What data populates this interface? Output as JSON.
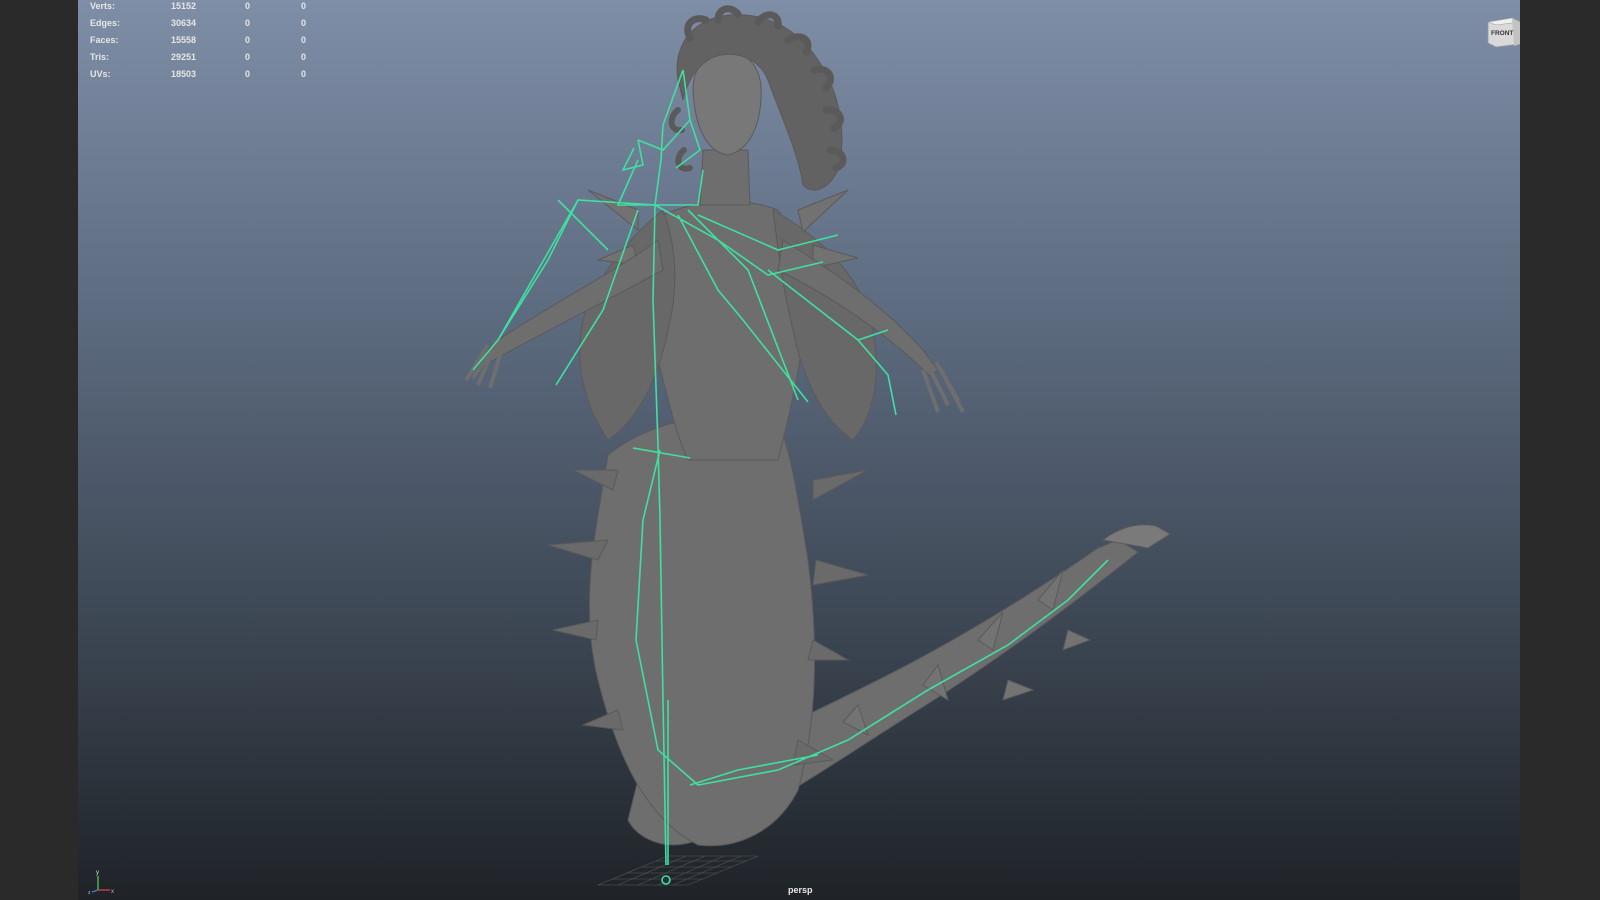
{
  "stats": {
    "rows": [
      {
        "label": "Verts:",
        "total": "15152",
        "selected": "0",
        "selected_2": "0"
      },
      {
        "label": "Edges:",
        "total": "30634",
        "selected": "0",
        "selected_2": "0"
      },
      {
        "label": "Faces:",
        "total": "15558",
        "selected": "0",
        "selected_2": "0"
      },
      {
        "label": "Tris:",
        "total": "29251",
        "selected": "0",
        "selected_2": "0"
      },
      {
        "label": "UVs:",
        "total": "18503",
        "selected": "0",
        "selected_2": "0"
      }
    ]
  },
  "viewcube": {
    "face_label": "FRONT"
  },
  "camera": {
    "name": "persp"
  },
  "axis": {
    "x": "x",
    "y": "y",
    "z": "z"
  },
  "colors": {
    "skeleton": "#3fe0a0",
    "mesh": "#6f6f6f",
    "viewport_top": "#7e8ea6",
    "viewport_bottom": "#1f2328"
  },
  "icons": [
    "view-cube-icon",
    "axis-gizmo-icon"
  ]
}
